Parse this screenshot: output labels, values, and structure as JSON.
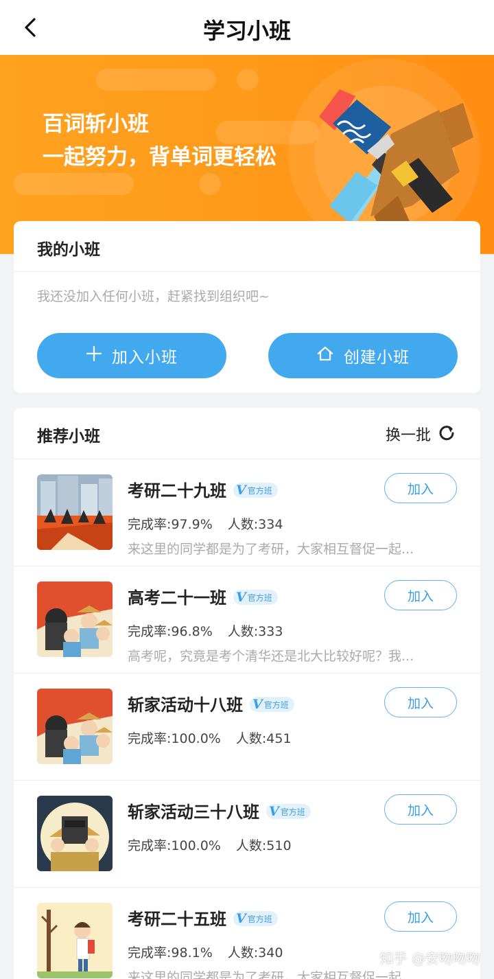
{
  "header": {
    "title": "学习小班",
    "back_icon": "chevron-left-icon"
  },
  "banner": {
    "line1": "百词斩小班",
    "line2": "一起努力，背单词更轻松",
    "art_icon": "paintbrush-icon"
  },
  "my_classes": {
    "heading": "我的小班",
    "empty_text": "我还没加入任何小班，赶紧找到组织吧~",
    "join_button": {
      "label": "加入小班",
      "icon": "plus-icon"
    },
    "create_button": {
      "label": "创建小班",
      "icon": "home-icon"
    }
  },
  "recommended": {
    "heading": "推荐小班",
    "refresh_label": "换一批",
    "refresh_icon": "refresh-icon",
    "items": [
      {
        "name": "考研二十九班",
        "badge": "官方班",
        "stats_completion": "完成率:97.9%",
        "stats_members": "人数:334",
        "desc": "来这里的同学都是为了考研，大家相互督促一起...",
        "join": "加入"
      },
      {
        "name": "高考二十一班",
        "badge": "官方班",
        "stats_completion": "完成率:96.8%",
        "stats_members": "人数:333",
        "desc": "高考呢，究竟是考个清华还是北大比较好呢？我...",
        "join": "加入"
      },
      {
        "name": "斩家活动十八班",
        "badge": "官方班",
        "stats_completion": "完成率:100.0%",
        "stats_members": "人数:451",
        "desc": "",
        "join": "加入"
      },
      {
        "name": "斩家活动三十八班",
        "badge": "官方班",
        "stats_completion": "完成率:100.0%",
        "stats_members": "人数:510",
        "desc": "",
        "join": "加入"
      },
      {
        "name": "考研二十五班",
        "badge": "官方班",
        "stats_completion": "完成率:98.1%",
        "stats_members": "人数:340",
        "desc": "来这里的同学都是为了考研，大家相互督促一起...",
        "join": "加入"
      }
    ]
  },
  "watermark": "知乎 @安吻吻吻"
}
